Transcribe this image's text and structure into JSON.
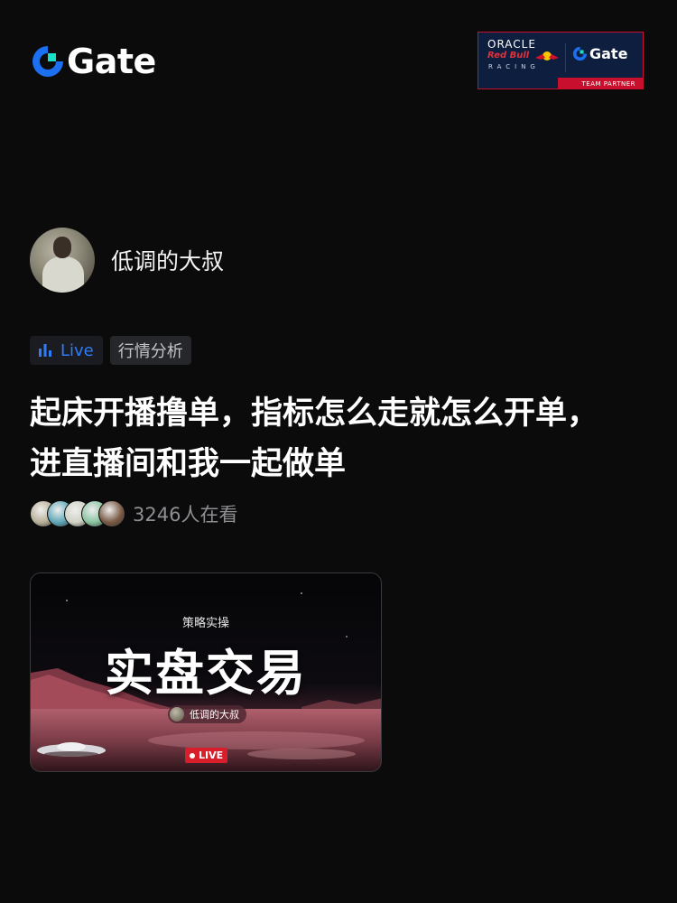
{
  "brand": {
    "name": "Gate",
    "accent": "#1d6ff2",
    "teal": "#17e1c6"
  },
  "partner": {
    "oracle": "ORACLE",
    "redbull": "Red Bull",
    "racing": "RACING",
    "gate": "Gate",
    "label": "TEAM PARTNER"
  },
  "author": {
    "name": "低调的大叔"
  },
  "tags": {
    "live": "Live",
    "category": "行情分析"
  },
  "post": {
    "title": "起床开播撸单，指标怎么走就怎么开单，进直播间和我一起做单"
  },
  "viewers": {
    "count_text": "3246人在看",
    "face_colors": [
      "#b9b09a",
      "#5fa7b8",
      "#cfd2c4",
      "#8bc4a1",
      "#7a5a44"
    ]
  },
  "stream_card": {
    "subtitle": "策略实操",
    "headline": "实盘交易",
    "host_name": "低调的大叔",
    "live_label": "LIVE"
  }
}
